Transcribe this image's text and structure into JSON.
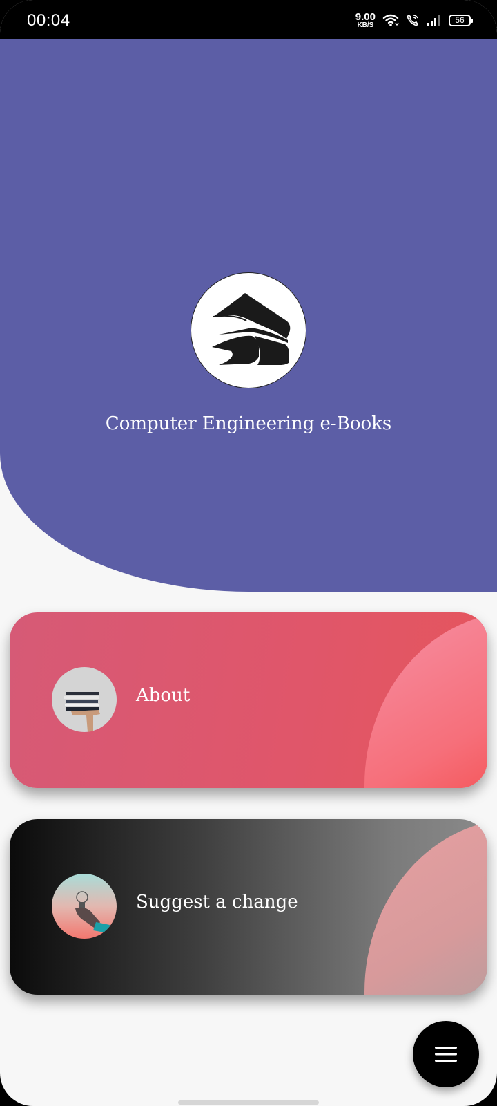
{
  "status_bar": {
    "time": "00:04",
    "net_speed_value": "9.00",
    "net_speed_unit": "KB/S",
    "battery": "56",
    "icons": [
      "wifi-icon",
      "wifi-calling-icon",
      "signal-icon",
      "battery-icon"
    ]
  },
  "header": {
    "title": "Computer Engineering e-Books",
    "logo_icon": "books-stack-icon",
    "color": "#5c5ea6"
  },
  "cards": [
    {
      "label": "About",
      "image": "hand-holding-books-photo"
    },
    {
      "label": "Suggest a change",
      "image": "hand-holding-lightbulb-photo"
    }
  ],
  "fab": {
    "icon": "menu-icon"
  }
}
